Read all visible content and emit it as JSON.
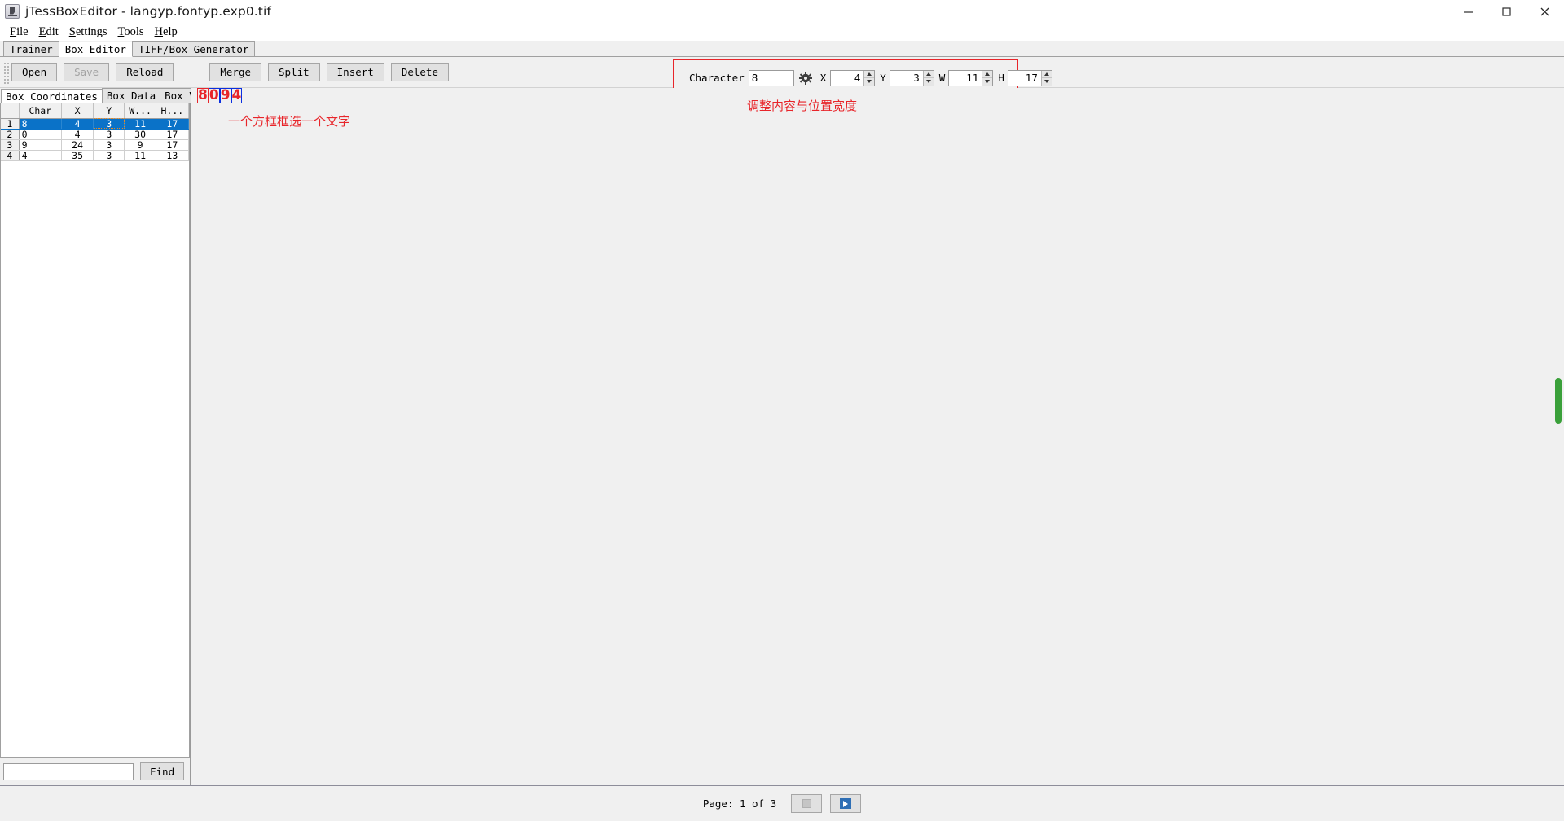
{
  "window": {
    "title": "jTessBoxEditor - langyp.fontyp.exp0.tif",
    "app_icon": "java-coffee-cup-icon",
    "minimize_label": "Minimize",
    "maximize_label": "Maximize",
    "close_label": "Close"
  },
  "menubar": {
    "items": [
      {
        "label": "File",
        "mnemonic": "F"
      },
      {
        "label": "Edit",
        "mnemonic": "E"
      },
      {
        "label": "Settings",
        "mnemonic": "S"
      },
      {
        "label": "Tools",
        "mnemonic": "T"
      },
      {
        "label": "Help",
        "mnemonic": "H"
      }
    ]
  },
  "tabs": {
    "items": [
      {
        "label": "Trainer",
        "active": false
      },
      {
        "label": "Box Editor",
        "active": true
      },
      {
        "label": "TIFF/Box Generator",
        "active": false
      }
    ]
  },
  "toolbar": {
    "open_label": "Open",
    "save_label": "Save",
    "reload_label": "Reload",
    "merge_label": "Merge",
    "split_label": "Split",
    "insert_label": "Insert",
    "delete_label": "Delete"
  },
  "char_panel": {
    "character_label": "Character",
    "character_value": "8",
    "gear_icon": "gear-icon",
    "x_label": "X",
    "x_value": "4",
    "y_label": "Y",
    "y_value": "3",
    "w_label": "W",
    "w_value": "11",
    "h_label": "H",
    "h_value": "17",
    "highlight_color": "#e8252a"
  },
  "left_panel": {
    "subtabs": [
      {
        "label": "Box Coordinates",
        "active": true
      },
      {
        "label": "Box Data",
        "active": false
      },
      {
        "label": "Box View",
        "active": false
      }
    ],
    "table": {
      "columns": [
        "",
        "Char",
        "X",
        "Y",
        "W...",
        "H..."
      ],
      "rows": [
        {
          "n": "1",
          "char": "8",
          "x": "4",
          "y": "3",
          "w": "11",
          "h": "17",
          "selected": true
        },
        {
          "n": "2",
          "char": "0",
          "x": "4",
          "y": "3",
          "w": "30",
          "h": "17",
          "selected": false
        },
        {
          "n": "3",
          "char": "9",
          "x": "24",
          "y": "3",
          "w": "9",
          "h": "17",
          "selected": false
        },
        {
          "n": "4",
          "char": "4",
          "x": "35",
          "y": "3",
          "w": "11",
          "h": "13",
          "selected": false
        }
      ]
    },
    "find": {
      "input_value": "",
      "placeholder": "",
      "button_label": "Find"
    }
  },
  "canvas": {
    "glyphs": [
      {
        "text": "8",
        "box": "red"
      },
      {
        "text": "0",
        "box": "blue"
      },
      {
        "text": "9",
        "box": "blue"
      },
      {
        "text": "4",
        "box": "blue"
      }
    ],
    "annotation_left": "一个方框框选一个文字",
    "annotation_right": "调整内容与位置宽度",
    "annotation_color": "#e8252a",
    "scrollbar_color": "#3aa03a"
  },
  "statusbar": {
    "page_text": "Page: 1 of 3",
    "prev_label": "Previous page",
    "next_label": "Next page"
  }
}
